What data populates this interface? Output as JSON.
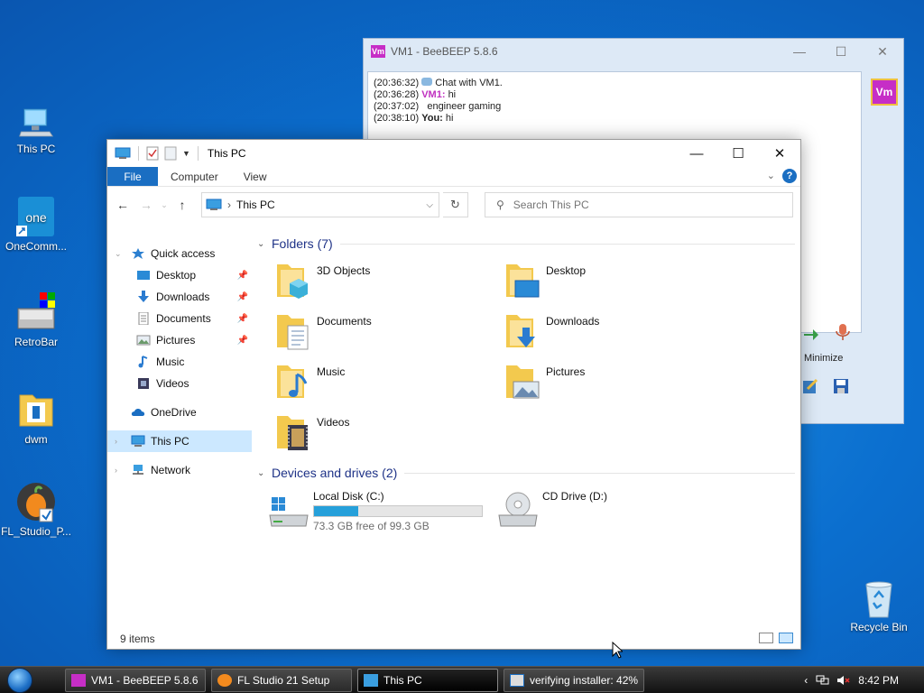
{
  "desktop": {
    "icons": [
      {
        "label": "This PC"
      },
      {
        "label": "OneComm..."
      },
      {
        "label": "RetroBar"
      },
      {
        "label": "dwm"
      },
      {
        "label": "FL_Studio_P..."
      },
      {
        "label": "Recycle Bin"
      }
    ]
  },
  "beebeep": {
    "title": "VM1 - BeeBEEP 5.8.6",
    "badge": "Vm",
    "chat": [
      {
        "time": "(20:36:32)",
        "who": "",
        "text": "Chat with VM1."
      },
      {
        "time": "(20:36:28)",
        "who": "VM1:",
        "text": "hi"
      },
      {
        "time": "(20:37:02)",
        "who": "",
        "text": "engineer gaming"
      },
      {
        "time": "(20:38:10)",
        "who": "You:",
        "text": "hi"
      }
    ],
    "minimize_label": "Minimize"
  },
  "explorer": {
    "title": "This PC",
    "ribbon": {
      "file": "File",
      "computer": "Computer",
      "view": "View",
      "help": "?"
    },
    "address": "This PC",
    "search_placeholder": "Search This PC",
    "nav": {
      "quick_access": "Quick access",
      "items": [
        {
          "label": "Desktop"
        },
        {
          "label": "Downloads"
        },
        {
          "label": "Documents"
        },
        {
          "label": "Pictures"
        },
        {
          "label": "Music"
        },
        {
          "label": "Videos"
        }
      ],
      "onedrive": "OneDrive",
      "thispc": "This PC",
      "network": "Network"
    },
    "folders_header": "Folders (7)",
    "folders": [
      {
        "name": "3D Objects"
      },
      {
        "name": "Desktop"
      },
      {
        "name": "Documents"
      },
      {
        "name": "Downloads"
      },
      {
        "name": "Music"
      },
      {
        "name": "Pictures"
      },
      {
        "name": "Videos"
      }
    ],
    "drives_header": "Devices and drives (2)",
    "drives": [
      {
        "name": "Local Disk (C:)",
        "free": "73.3 GB free of 99.3 GB",
        "used_fraction": 0.262
      },
      {
        "name": "CD Drive (D:)"
      }
    ],
    "status": "9 items"
  },
  "taskbar": {
    "buttons": [
      {
        "label": "VM1 - BeeBEEP 5.8.6"
      },
      {
        "label": "FL Studio 21 Setup"
      },
      {
        "label": "This PC"
      },
      {
        "label": "verifying installer: 42%"
      }
    ],
    "clock": "8:42 PM"
  },
  "colors": {
    "accent": "#1a6ec2",
    "selection": "#cce8ff",
    "drive_fill": "#26a0da",
    "header_blue": "#1e3287"
  }
}
